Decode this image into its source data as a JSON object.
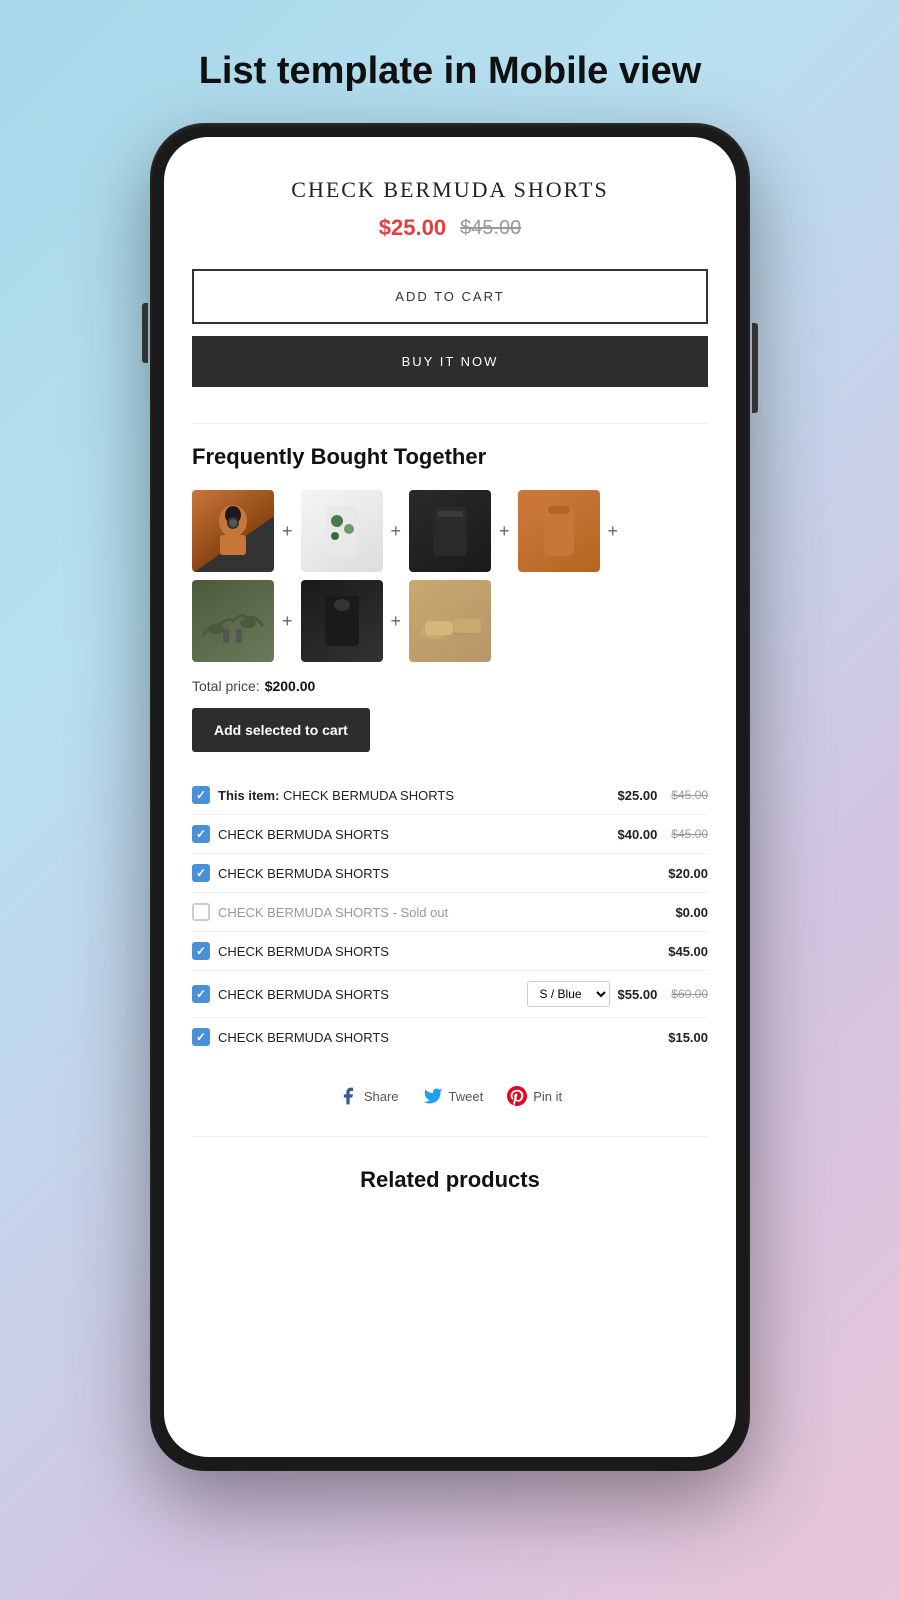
{
  "page": {
    "title": "List template in Mobile view"
  },
  "product": {
    "name": "CHECK BERMUDA SHORTS",
    "sale_price": "$25.00",
    "original_price": "$45.00",
    "add_to_cart_label": "ADD TO CART",
    "buy_now_label": "BUY IT NOW"
  },
  "fbt": {
    "section_title": "Frequently Bought Together",
    "total_label": "Total price:",
    "total_price": "$200.00",
    "add_selected_label": "Add selected to cart"
  },
  "items": [
    {
      "checked": true,
      "bold": true,
      "prefix": "This item:",
      "name": "CHECK BERMUDA SHORTS",
      "price": "$25.00",
      "original": "$45.00",
      "sold_out": false
    },
    {
      "checked": true,
      "bold": false,
      "prefix": "",
      "name": "CHECK BERMUDA SHORTS",
      "price": "$40.00",
      "original": "$45.00",
      "sold_out": false
    },
    {
      "checked": true,
      "bold": false,
      "prefix": "",
      "name": "CHECK BERMUDA SHORTS",
      "price": "$20.00",
      "original": "",
      "sold_out": false
    },
    {
      "checked": false,
      "bold": false,
      "prefix": "",
      "name": "CHECK BERMUDA SHORTS - Sold out",
      "price": "$0.00",
      "original": "",
      "sold_out": true
    },
    {
      "checked": true,
      "bold": false,
      "prefix": "",
      "name": "CHECK BERMUDA SHORTS",
      "price": "$45.00",
      "original": "",
      "sold_out": false
    },
    {
      "checked": true,
      "bold": false,
      "prefix": "",
      "name": "CHECK BERMUDA SHORTS",
      "price": "$55.00",
      "original": "$60.00",
      "variant": "S / Blue",
      "sold_out": false
    },
    {
      "checked": true,
      "bold": false,
      "prefix": "",
      "name": "CHECK BERMUDA SHORTS",
      "price": "$15.00",
      "original": "",
      "sold_out": false
    }
  ],
  "social": {
    "share_label": "Share",
    "tweet_label": "Tweet",
    "pin_label": "Pin it"
  },
  "related": {
    "title": "Related products"
  }
}
